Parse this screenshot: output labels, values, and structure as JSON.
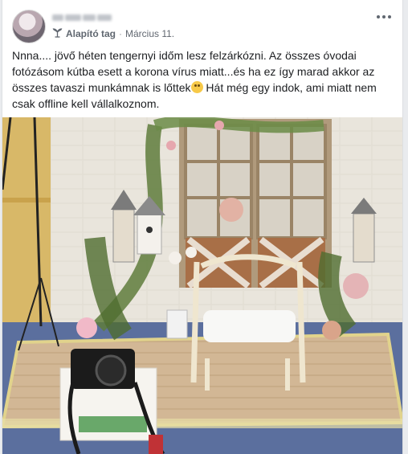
{
  "post": {
    "author": {
      "role_label": "Alapító tag",
      "separator": "·",
      "date": "Március 11."
    },
    "text": "Nnna.... jövő héten tengernyi időm lesz felzárkózni. Az összes óvodai fotózásom kútba esett a korona vírus miatt...és ha ez így marad akkor az összes tavaszi munkámnak is lőttek",
    "text_after_emoji": " Hát még egy indok, ami miatt nem csak offline kell vállalkoznom.",
    "icons": {
      "more": "more-options-icon",
      "badge": "founder-badge-icon",
      "emoji": "grimacing-face-emoji"
    },
    "colors": {
      "text": "#1c1e21",
      "meta": "#616770",
      "background": "#e9ebee"
    }
  }
}
